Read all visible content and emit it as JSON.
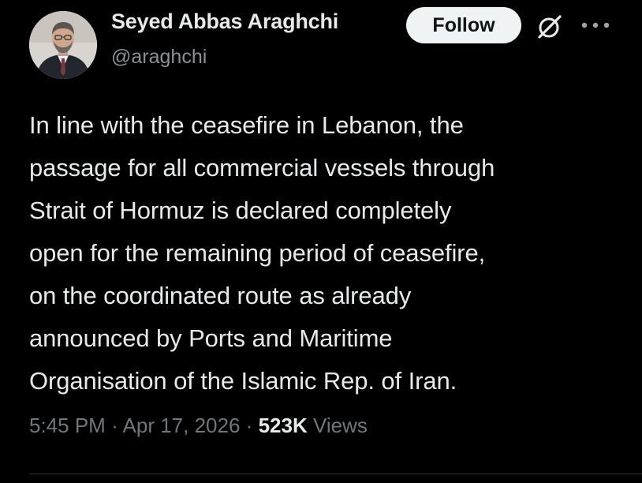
{
  "author": {
    "display_name": "Seyed Abbas Araghchi",
    "handle": "@araghchi"
  },
  "actions": {
    "follow_label": "Follow",
    "grok_icon": "grok-icon",
    "more_icon": "more-icon"
  },
  "tweet": {
    "lines": [
      "In line with the ceasefire in Lebanon, the",
      "passage for all commercial vessels through",
      "Strait of Hormuz is declared completely",
      "open for the remaining period of ceasefire,",
      "on the coordinated route as already",
      "announced by Ports and Maritime",
      "Organisation of the Islamic Rep. of Iran."
    ]
  },
  "meta": {
    "time": "5:45 PM",
    "separator": "·",
    "date": "Apr 17, 2026",
    "views_count": "523K",
    "views_label": "Views"
  },
  "colors": {
    "background": "#000000",
    "text_primary": "#e7e9ea",
    "text_secondary": "#71767b",
    "follow_bg": "#eff3f4",
    "divider": "#2f3336"
  }
}
